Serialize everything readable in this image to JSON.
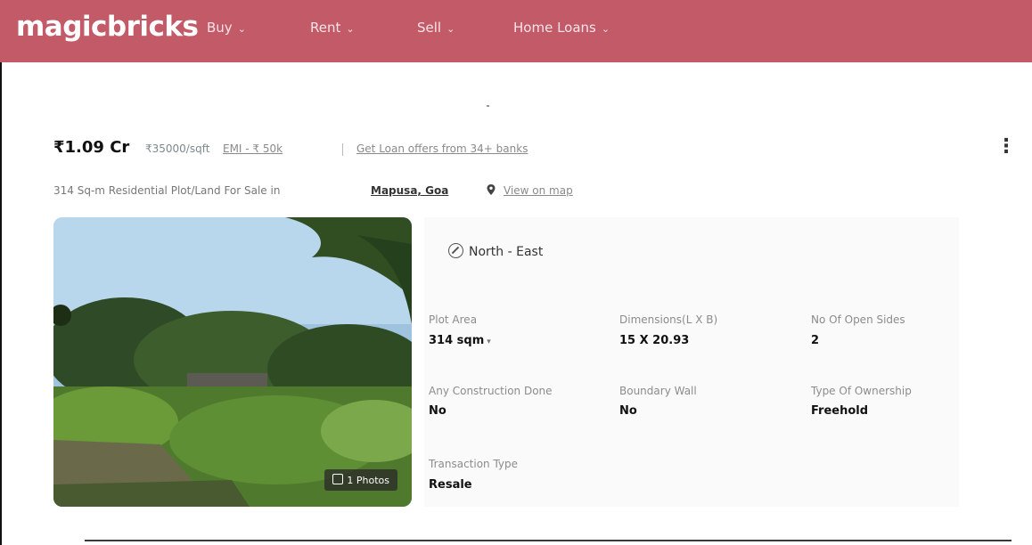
{
  "header": {
    "logo": "magicbricks",
    "nav": [
      {
        "label": "Buy"
      },
      {
        "label": "Rent"
      },
      {
        "label": "Sell"
      },
      {
        "label": "Home Loans"
      }
    ],
    "brand_color": "#c25a68"
  },
  "listing": {
    "price": "₹1.09 Cr",
    "price_per_sqft": "₹35000/sqft",
    "emi": "EMI - ₹ 50k",
    "loan_offers": "Get Loan offers from 34+ banks",
    "title": "314 Sq-m Residential Plot/Land For Sale in",
    "locality": "Mapusa, Goa",
    "map_link": "View on map",
    "photos_count": "1 Photos",
    "facing": "North - East",
    "details": [
      {
        "label": "Plot Area",
        "value": "314 sqm"
      },
      {
        "label": "Dimensions(L X B)",
        "value": "15 X 20.93"
      },
      {
        "label": "No Of Open Sides",
        "value": "2"
      },
      {
        "label": "Any Construction Done",
        "value": "No"
      },
      {
        "label": "Boundary Wall",
        "value": "No"
      },
      {
        "label": "Type Of Ownership",
        "value": "Freehold"
      },
      {
        "label": "Transaction Type",
        "value": "Resale"
      }
    ]
  },
  "icons": {
    "menu": "more-vertical-icon",
    "pin": "location-pin-icon",
    "compass": "compass-icon",
    "photo": "photo-icon",
    "chevron": "chevron-down-icon"
  }
}
